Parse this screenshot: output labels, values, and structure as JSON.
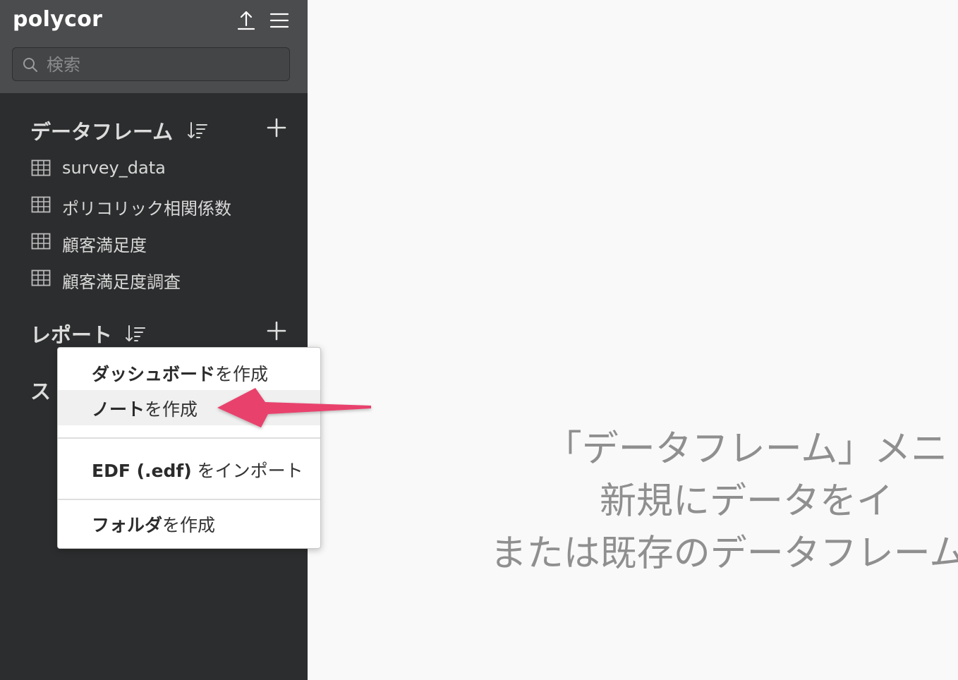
{
  "sidebar": {
    "project_name": "polycor",
    "search": {
      "placeholder": "検索",
      "value": ""
    },
    "dataframes": {
      "title": "データフレーム",
      "items": [
        {
          "label": "survey_data",
          "icon": "table-icon"
        },
        {
          "label": "ポリコリック相関係数",
          "icon": "table-icon"
        },
        {
          "label": "顧客満足度",
          "icon": "table-icon"
        },
        {
          "label": "顧客満足度調査",
          "icon": "table-icon"
        }
      ]
    },
    "reports": {
      "title": "レポート"
    },
    "next_section_partial": "ス"
  },
  "menu": {
    "items": [
      {
        "bold": "ダッシュボード",
        "rest": "を作成",
        "highlighted": false
      },
      {
        "bold": "ノート",
        "rest": "を作成",
        "highlighted": true
      },
      {
        "bold": "EDF (.edf)",
        "rest": " をインポート",
        "highlighted": false
      },
      {
        "bold": "フォルダ",
        "rest": "を作成",
        "highlighted": false
      }
    ]
  },
  "main": {
    "empty_message": [
      "「データフレーム」メニ",
      "新規にデータをイ",
      "または既存のデータフレームを"
    ]
  },
  "colors": {
    "sidebar_bg": "#2c2d2e",
    "sidebar_header_bg": "#4b4c4e",
    "main_bg": "#f9f9f9",
    "annotation_arrow": "#e8426c"
  },
  "icons": [
    "upload-icon",
    "hamburger-menu-icon",
    "search-icon",
    "sort-icon",
    "plus-icon",
    "table-icon",
    "annotation-arrow"
  ]
}
